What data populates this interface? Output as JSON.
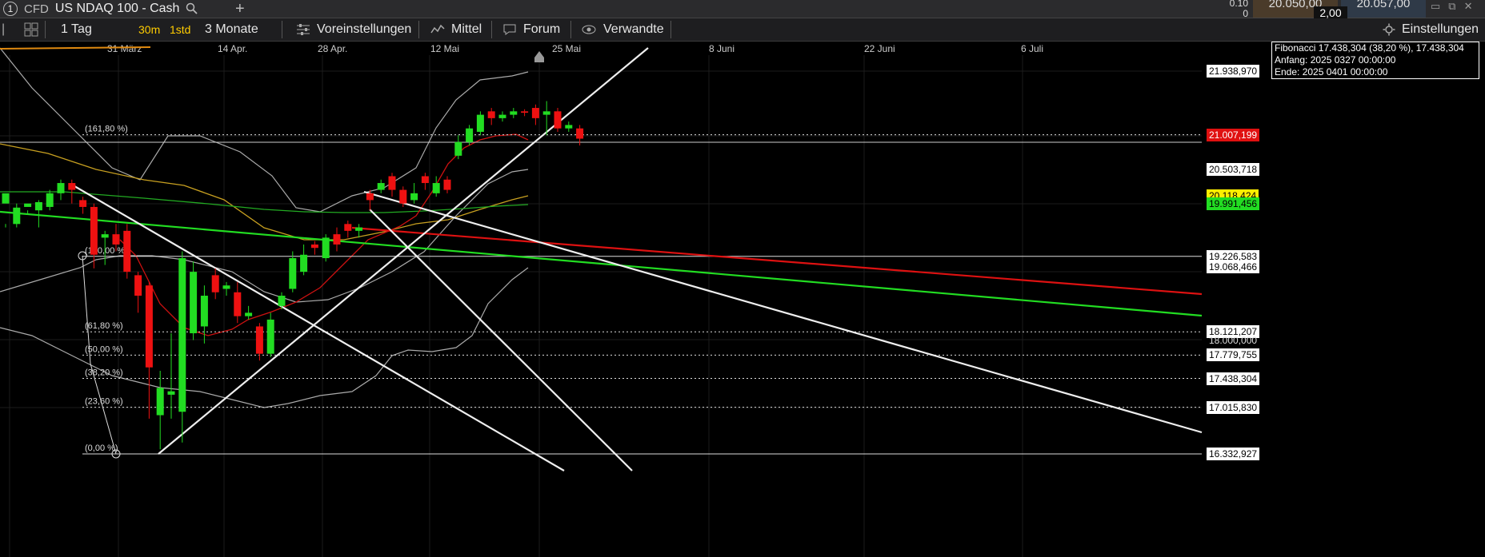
{
  "title": {
    "number": "1",
    "type": "CFD",
    "name": "US NDAQ 100 - Cash"
  },
  "quote": {
    "small_top": "0.10",
    "small_bottom": "0",
    "sell": "20.050,00",
    "buy": "20.057,00",
    "spread": "2,00"
  },
  "toolbar": {
    "interval": "1 Tag",
    "res_a": "30m",
    "res_b": "1std",
    "range": "3 Monate",
    "presets": "Voreinstellungen",
    "averages": "Mittel",
    "forum": "Forum",
    "related": "Verwandte",
    "settings": "Einstellungen"
  },
  "x_axis_labels": [
    "31 März",
    "14 Apr.",
    "28 Apr.",
    "12 Mai",
    "25 Mai",
    "8 Juni",
    "22 Juni",
    "6 Juli"
  ],
  "fib_levels": [
    {
      "label": "(161,80 %)",
      "price": 21007.199
    },
    {
      "label": "(100,00 %)",
      "price": 19226.583
    },
    {
      "label": "(61,80 %)",
      "price": 18121.207
    },
    {
      "label": "(50,00 %)",
      "price": 17779.755
    },
    {
      "label": "(38,20 %)",
      "price": 17438.304
    },
    {
      "label": "(23,60 %)",
      "price": 17015.83
    },
    {
      "label": "(0,00 %)",
      "price": 16332.927
    }
  ],
  "price_scale": [
    {
      "text": "21.938,970",
      "price": 21938.97,
      "style": "white"
    },
    {
      "text": "21.007,199",
      "price": 21007.199,
      "style": "red"
    },
    {
      "text": "20.503,718",
      "price": 20503.718,
      "style": "white"
    },
    {
      "text": "20.118,424",
      "price": 20118.424,
      "style": "yellow"
    },
    {
      "text": "19.991,456",
      "price": 19991.456,
      "style": "green"
    },
    {
      "text": "19.226,583",
      "price": 19226.583,
      "style": "white"
    },
    {
      "text": "19.068,466",
      "price": 19068.466,
      "style": "white"
    },
    {
      "text": "18.121,207",
      "price": 18121.207,
      "style": "white"
    },
    {
      "text": "18.000,000",
      "price": 18000.0,
      "style": "plain"
    },
    {
      "text": "17.779,755",
      "price": 17779.755,
      "style": "white"
    },
    {
      "text": "17.438,304",
      "price": 17438.304,
      "style": "white"
    },
    {
      "text": "17.015,830",
      "price": 17015.83,
      "style": "white"
    },
    {
      "text": "16.332,927",
      "price": 16332.927,
      "style": "white"
    }
  ],
  "fib_tooltip": {
    "line1": "Fibonacci 17.438,304 (38,20 %), 17.438,304",
    "line2": "Anfang: 2025 0327 00:00:00",
    "line3": "Ende: 2025 0401 00:00:00"
  },
  "colors": {
    "up": "#22dd22",
    "down": "#ee1111",
    "accent": "#ffcc00"
  },
  "chart_data": {
    "type": "candlestick",
    "y_range": [
      16250,
      22300
    ],
    "candles": [
      [
        20000,
        20150,
        19700,
        19650
      ],
      [
        19700,
        19940,
        20000,
        19650
      ],
      [
        19950,
        20000,
        19900,
        19850
      ],
      [
        19900,
        20020,
        20050,
        19650
      ],
      [
        19950,
        20150,
        20200,
        19900
      ],
      [
        20150,
        20300,
        20350,
        20050
      ],
      [
        20300,
        20200,
        20350,
        20000
      ],
      [
        20050,
        19950,
        20100,
        19850
      ],
      [
        19950,
        19250,
        20000,
        19050
      ],
      [
        19500,
        19550,
        19600,
        19100
      ],
      [
        19550,
        19400,
        19700,
        19300
      ],
      [
        19600,
        19000,
        19700,
        18900
      ],
      [
        18950,
        18650,
        19000,
        18400
      ],
      [
        18800,
        17600,
        18850,
        16850
      ],
      [
        16900,
        17300,
        17550,
        16400
      ],
      [
        17200,
        17250,
        18100,
        16850
      ],
      [
        16950,
        19200,
        19300,
        16500
      ],
      [
        18100,
        19000,
        19150,
        18000
      ],
      [
        18200,
        18650,
        18800,
        17950
      ],
      [
        18950,
        18700,
        19050,
        18600
      ],
      [
        18750,
        18800,
        18850,
        18650
      ],
      [
        18700,
        18350,
        18850,
        18250
      ],
      [
        18350,
        18400,
        18500,
        18300
      ],
      [
        18200,
        17800,
        18250,
        17700
      ],
      [
        17800,
        18300,
        18400,
        17750
      ],
      [
        18500,
        18650,
        18700,
        18450
      ],
      [
        18750,
        19200,
        19300,
        18700
      ],
      [
        19000,
        19250,
        19400,
        18950
      ],
      [
        19400,
        19350,
        19450,
        19250
      ],
      [
        19200,
        19500,
        19550,
        19150
      ],
      [
        19550,
        19400,
        19650,
        19300
      ],
      [
        19700,
        19600,
        19750,
        19500
      ],
      [
        19600,
        19650,
        19700,
        19500
      ],
      [
        20150,
        20050,
        20200,
        19900
      ],
      [
        20200,
        20300,
        20350,
        20150
      ],
      [
        20400,
        20200,
        20450,
        20100
      ],
      [
        20200,
        20000,
        20250,
        19950
      ],
      [
        20050,
        20150,
        20300,
        20000
      ],
      [
        20400,
        20300,
        20450,
        20200
      ],
      [
        20150,
        20300,
        20400,
        20100
      ],
      [
        20350,
        20200,
        20400,
        20150
      ],
      [
        20700,
        20900,
        21000,
        20650
      ],
      [
        20900,
        21100,
        21150,
        20850
      ],
      [
        21050,
        21300,
        21350,
        21000
      ],
      [
        21350,
        21250,
        21400,
        21150
      ],
      [
        21250,
        21300,
        21350,
        21200
      ],
      [
        21300,
        21350,
        21400,
        21250
      ],
      [
        21350,
        21330,
        21380,
        21280
      ],
      [
        21400,
        21250,
        21450,
        21150
      ],
      [
        21300,
        21350,
        21500,
        21000
      ],
      [
        21350,
        21100,
        21400,
        21050
      ],
      [
        21100,
        21150,
        21200,
        21050
      ],
      [
        21100,
        20950,
        21150,
        20850
      ]
    ]
  }
}
